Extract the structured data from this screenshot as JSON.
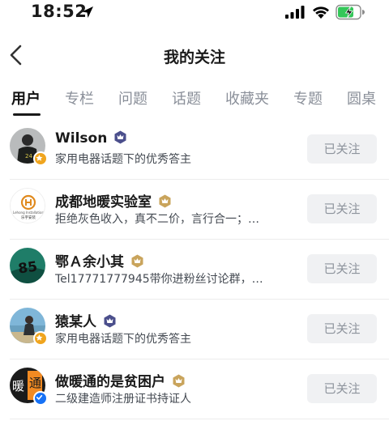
{
  "status_bar": {
    "time": "18:52",
    "icons": [
      "location-arrow-icon",
      "cellular-signal-icon",
      "wifi-icon",
      "battery-charging-icon"
    ]
  },
  "nav": {
    "back_icon": "chevron-left-icon",
    "title": "我的关注"
  },
  "tabs": [
    {
      "label": "用户",
      "active": true
    },
    {
      "label": "专栏",
      "active": false
    },
    {
      "label": "问题",
      "active": false
    },
    {
      "label": "话题",
      "active": false
    },
    {
      "label": "收藏夹",
      "active": false
    },
    {
      "label": "专题",
      "active": false
    },
    {
      "label": "圆桌",
      "active": false
    }
  ],
  "users": [
    {
      "name": "Wilson",
      "badge": "crown-badge-icon",
      "badge_color": "#4b4f8c",
      "desc": "家用电器话题下的优秀答主",
      "button": "已关注",
      "avatar_badge": "star-badge-icon",
      "avatar_badge_color": "#f0a51e"
    },
    {
      "name": "成都地暖实验室",
      "badge": "crown-badge-icon",
      "badge_color": "#c9a45c",
      "desc": "拒绝灰色收入，真不二价，言行合一；…",
      "button": "已关注",
      "avatar_logo_text": "Lehong Installation",
      "avatar_logo_cn": "乐宇安装"
    },
    {
      "name": "鄂Ａ余小其",
      "badge": "crown-badge-icon",
      "badge_color": "#c9a45c",
      "desc": "Tel17771777945带你进粉丝讨论群，…",
      "button": "已关注",
      "avatar_text": "85"
    },
    {
      "name": "猿某人",
      "badge": "crown-badge-icon",
      "badge_color": "#4b4f8c",
      "desc": "家用电器话题下的优秀答主",
      "button": "已关注",
      "avatar_badge": "star-badge-icon",
      "avatar_badge_color": "#f0a51e"
    },
    {
      "name": "做暖通的是贫困户",
      "badge": "crown-badge-icon",
      "badge_color": "#c9a45c",
      "desc": "二级建造师注册证书持证人",
      "button": "已关注",
      "avatar_chars": [
        "暖",
        "通"
      ],
      "avatar_badge": "verified-check-icon",
      "avatar_badge_color": "#1772f6"
    }
  ]
}
